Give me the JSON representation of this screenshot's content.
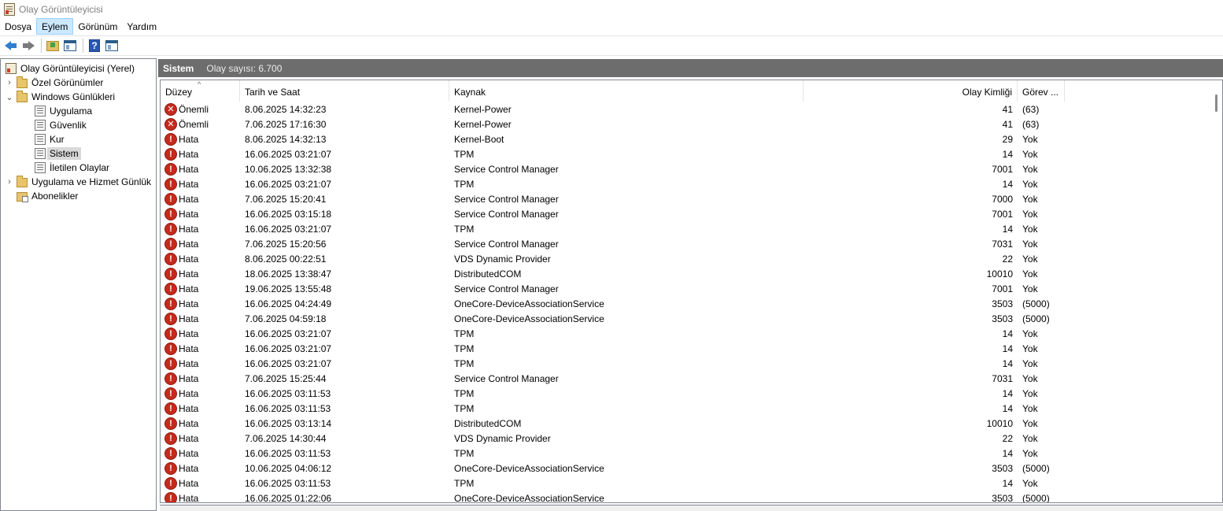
{
  "window": {
    "title": "Olay Görüntüleyicisi"
  },
  "menu": [
    {
      "label": "Dosya",
      "active": false
    },
    {
      "label": "Eylem",
      "active": true
    },
    {
      "label": "Görünüm",
      "active": false
    },
    {
      "label": "Yardım",
      "active": false
    }
  ],
  "tree": {
    "root": "Olay Görüntüleyicisi (Yerel)",
    "custom_views": "Özel Görünümler",
    "windows_logs": "Windows Günlükleri",
    "application": "Uygulama",
    "security": "Güvenlik",
    "setup": "Kur",
    "system": "Sistem",
    "forwarded": "İletilen Olaylar",
    "app_service_logs": "Uygulama ve Hizmet Günlük",
    "subscriptions": "Abonelikler"
  },
  "header": {
    "title": "Sistem",
    "count": "Olay sayısı: 6.700"
  },
  "columns": {
    "level": "Düzey",
    "date": "Tarih ve Saat",
    "source": "Kaynak",
    "event_id": "Olay Kimliği",
    "task": "Görev ..."
  },
  "rows": [
    {
      "level": "Önemli",
      "kind": "critical",
      "date": "8.06.2025 14:32:23",
      "source": "Kernel-Power",
      "id": "41",
      "task": "(63)"
    },
    {
      "level": "Önemli",
      "kind": "critical",
      "date": "7.06.2025 17:16:30",
      "source": "Kernel-Power",
      "id": "41",
      "task": "(63)"
    },
    {
      "level": "Hata",
      "kind": "error",
      "date": "8.06.2025 14:32:13",
      "source": "Kernel-Boot",
      "id": "29",
      "task": "Yok"
    },
    {
      "level": "Hata",
      "kind": "error",
      "date": "16.06.2025 03:21:07",
      "source": "TPM",
      "id": "14",
      "task": "Yok"
    },
    {
      "level": "Hata",
      "kind": "error",
      "date": "10.06.2025 13:32:38",
      "source": "Service Control Manager",
      "id": "7001",
      "task": "Yok"
    },
    {
      "level": "Hata",
      "kind": "error",
      "date": "16.06.2025 03:21:07",
      "source": "TPM",
      "id": "14",
      "task": "Yok"
    },
    {
      "level": "Hata",
      "kind": "error",
      "date": "7.06.2025 15:20:41",
      "source": "Service Control Manager",
      "id": "7000",
      "task": "Yok"
    },
    {
      "level": "Hata",
      "kind": "error",
      "date": "16.06.2025 03:15:18",
      "source": "Service Control Manager",
      "id": "7001",
      "task": "Yok"
    },
    {
      "level": "Hata",
      "kind": "error",
      "date": "16.06.2025 03:21:07",
      "source": "TPM",
      "id": "14",
      "task": "Yok"
    },
    {
      "level": "Hata",
      "kind": "error",
      "date": "7.06.2025 15:20:56",
      "source": "Service Control Manager",
      "id": "7031",
      "task": "Yok"
    },
    {
      "level": "Hata",
      "kind": "error",
      "date": "8.06.2025 00:22:51",
      "source": "VDS Dynamic Provider",
      "id": "22",
      "task": "Yok"
    },
    {
      "level": "Hata",
      "kind": "error",
      "date": "18.06.2025 13:38:47",
      "source": "DistributedCOM",
      "id": "10010",
      "task": "Yok"
    },
    {
      "level": "Hata",
      "kind": "error",
      "date": "19.06.2025 13:55:48",
      "source": "Service Control Manager",
      "id": "7001",
      "task": "Yok"
    },
    {
      "level": "Hata",
      "kind": "error",
      "date": "16.06.2025 04:24:49",
      "source": "OneCore-DeviceAssociationService",
      "id": "3503",
      "task": "(5000)"
    },
    {
      "level": "Hata",
      "kind": "error",
      "date": "7.06.2025 04:59:18",
      "source": "OneCore-DeviceAssociationService",
      "id": "3503",
      "task": "(5000)"
    },
    {
      "level": "Hata",
      "kind": "error",
      "date": "16.06.2025 03:21:07",
      "source": "TPM",
      "id": "14",
      "task": "Yok"
    },
    {
      "level": "Hata",
      "kind": "error",
      "date": "16.06.2025 03:21:07",
      "source": "TPM",
      "id": "14",
      "task": "Yok"
    },
    {
      "level": "Hata",
      "kind": "error",
      "date": "16.06.2025 03:21:07",
      "source": "TPM",
      "id": "14",
      "task": "Yok"
    },
    {
      "level": "Hata",
      "kind": "error",
      "date": "7.06.2025 15:25:44",
      "source": "Service Control Manager",
      "id": "7031",
      "task": "Yok"
    },
    {
      "level": "Hata",
      "kind": "error",
      "date": "16.06.2025 03:11:53",
      "source": "TPM",
      "id": "14",
      "task": "Yok"
    },
    {
      "level": "Hata",
      "kind": "error",
      "date": "16.06.2025 03:11:53",
      "source": "TPM",
      "id": "14",
      "task": "Yok"
    },
    {
      "level": "Hata",
      "kind": "error",
      "date": "16.06.2025 03:13:14",
      "source": "DistributedCOM",
      "id": "10010",
      "task": "Yok"
    },
    {
      "level": "Hata",
      "kind": "error",
      "date": "7.06.2025 14:30:44",
      "source": "VDS Dynamic Provider",
      "id": "22",
      "task": "Yok"
    },
    {
      "level": "Hata",
      "kind": "error",
      "date": "16.06.2025 03:11:53",
      "source": "TPM",
      "id": "14",
      "task": "Yok"
    },
    {
      "level": "Hata",
      "kind": "error",
      "date": "10.06.2025 04:06:12",
      "source": "OneCore-DeviceAssociationService",
      "id": "3503",
      "task": "(5000)"
    },
    {
      "level": "Hata",
      "kind": "error",
      "date": "16.06.2025 03:11:53",
      "source": "TPM",
      "id": "14",
      "task": "Yok"
    },
    {
      "level": "Hata",
      "kind": "error",
      "date": "16.06.2025 01:22:06",
      "source": "OneCore-DeviceAssociationService",
      "id": "3503",
      "task": "(5000)"
    }
  ],
  "icons": {
    "critical": "critical-x-icon",
    "error": "error-exclamation-icon"
  }
}
